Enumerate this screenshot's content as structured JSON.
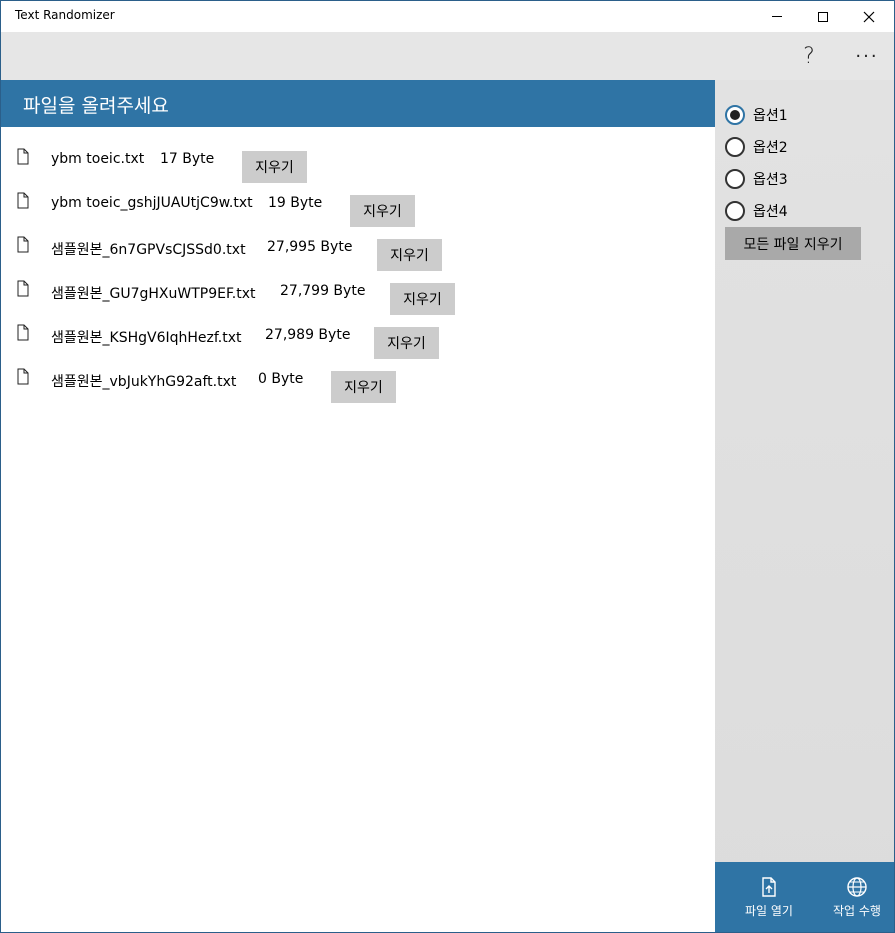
{
  "window": {
    "title": "Text Randomizer"
  },
  "command_bar": {
    "help_label": "?",
    "more_label": "···"
  },
  "main": {
    "header_title": "파일을 올려주세요",
    "delete_label": "지우기",
    "files": [
      {
        "name": "ybm toeic.txt",
        "size": "17 Byte"
      },
      {
        "name": "ybm toeic_gshjJUAUtjC9w.txt",
        "size": "19 Byte"
      },
      {
        "name": "샘플원본_6n7GPVsCJSSd0.txt",
        "size": "27,995 Byte"
      },
      {
        "name": "샘플원본_GU7gHXuWTP9EF.txt",
        "size": "27,799 Byte"
      },
      {
        "name": "샘플원본_KSHgV6IqhHezf.txt",
        "size": "27,989 Byte"
      },
      {
        "name": "샘플원본_vbJukYhG92aft.txt",
        "size": "0 Byte"
      }
    ]
  },
  "side": {
    "options": [
      {
        "label": "옵션1",
        "checked": true
      },
      {
        "label": "옵션2",
        "checked": false
      },
      {
        "label": "옵션3",
        "checked": false
      },
      {
        "label": "옵션4",
        "checked": false
      }
    ],
    "clear_all_label": "모든 파일 지우기",
    "open_file_label": "파일 열기",
    "run_label": "작업 수행"
  },
  "colors": {
    "accent": "#2f74a5",
    "command_bar_bg": "#e6e6e6",
    "button_bg": "#cccccc"
  },
  "icons": {
    "file": "file-icon",
    "open_file": "open-file-icon",
    "run": "globe-icon"
  }
}
